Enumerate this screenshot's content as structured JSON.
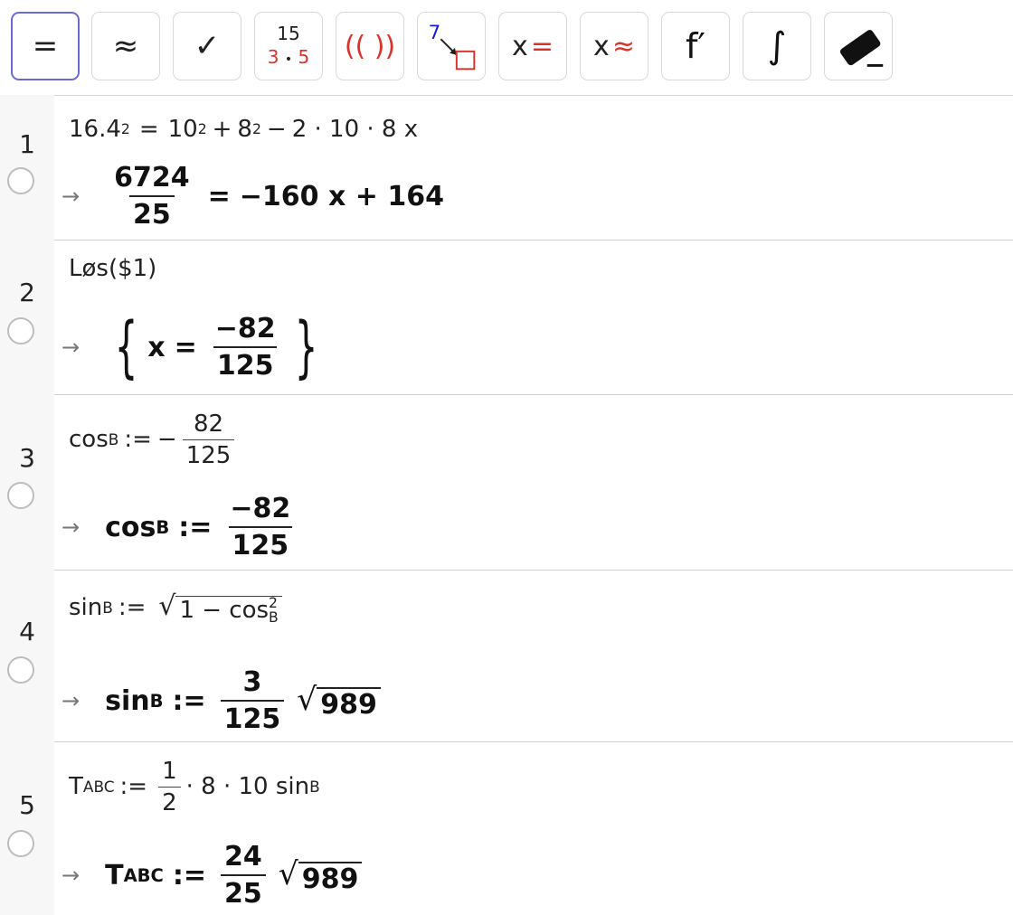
{
  "toolbar": {
    "evaluate": "=",
    "numeric": "≈",
    "keep_input": "✓",
    "factor_top": "15",
    "factor_a": "3",
    "factor_dot": "•",
    "factor_b": "5",
    "expand": "(( ))",
    "substitute_num": "7",
    "solve_x": "x",
    "solve_eq": "=",
    "nsolve_x": "x",
    "nsolve_approx": "≈",
    "derivative": "f′",
    "integral": "∫"
  },
  "rows": [
    {
      "number": "1",
      "input": {
        "a": "16.4",
        "a_exp": "2",
        "eq": "=",
        "b": "10",
        "b_exp": "2",
        "plus": "+",
        "c": "8",
        "c_exp": "2",
        "minus": "−",
        "rest": "2 · 10 · 8 x"
      },
      "output": {
        "arrow": "→",
        "num": "6724",
        "den": "25",
        "eq": "=",
        "rhs": "−160 x + 164"
      }
    },
    {
      "number": "2",
      "input": {
        "text": "Løs($1)"
      },
      "output": {
        "arrow": "→",
        "lbrace": "{",
        "var": "x",
        "eq": "=",
        "num": "−82",
        "den": "125",
        "rbrace": "}"
      }
    },
    {
      "number": "3",
      "input": {
        "name": "cos",
        "sub": "B",
        "assign": ":=",
        "minus": "−",
        "num": "82",
        "den": "125"
      },
      "output": {
        "arrow": "→",
        "name": "cos",
        "sub": "B",
        "assign": ":=",
        "num": "−82",
        "den": "125"
      }
    },
    {
      "number": "4",
      "input": {
        "name": "sin",
        "sub": "B",
        "assign": ":=",
        "rad_a": "1 − cos",
        "rad_sup": "2",
        "rad_sub": "B"
      },
      "output": {
        "arrow": "→",
        "name": "sin",
        "sub": "B",
        "assign": ":=",
        "num": "3",
        "den": "125",
        "radicand": "989"
      }
    },
    {
      "number": "5",
      "input": {
        "name": "T",
        "sub": "ABC",
        "assign": ":=",
        "num": "1",
        "den": "2",
        "rest": "· 8 · 10 sin",
        "rest_sub": "B"
      },
      "output": {
        "arrow": "→",
        "name": "T",
        "sub": "ABC",
        "assign": ":=",
        "num": "24",
        "den": "25",
        "radicand": "989"
      }
    }
  ]
}
